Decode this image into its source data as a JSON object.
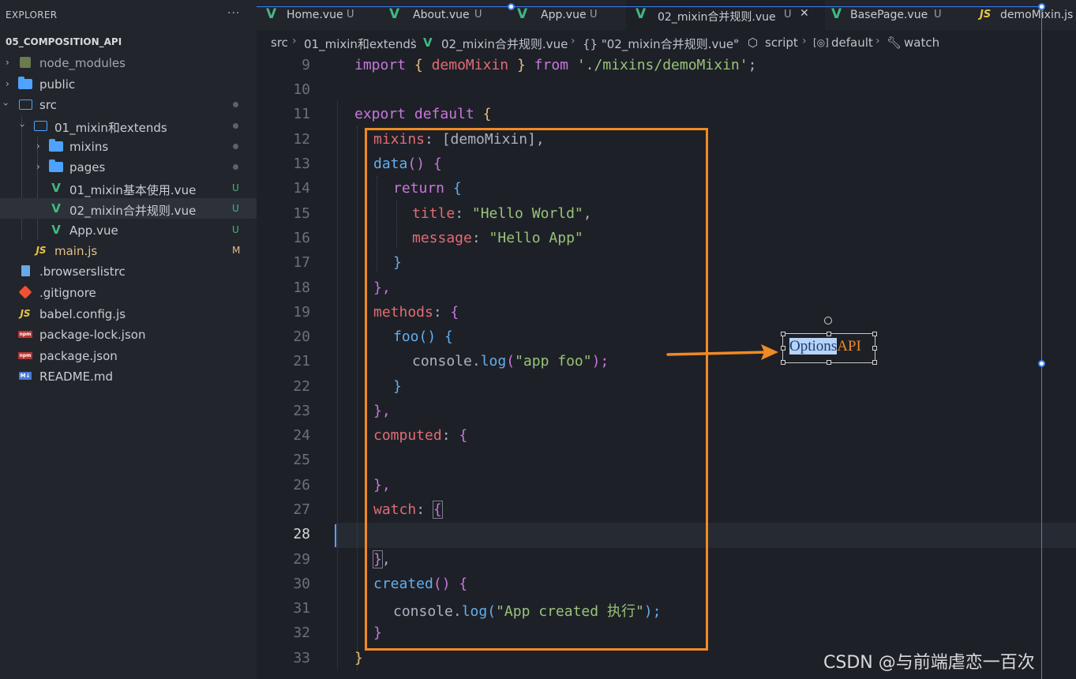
{
  "explorer": {
    "title": "EXPLORER",
    "more_label": "···",
    "project": "05_COMPOSITION_API",
    "items": [
      {
        "label": "node_modules",
        "badge": ""
      },
      {
        "label": "public",
        "badge": ""
      },
      {
        "label": "src",
        "badge": "dot"
      },
      {
        "label": "01_mixin和extends",
        "badge": "dot"
      },
      {
        "label": "mixins",
        "badge": "dot"
      },
      {
        "label": "pages",
        "badge": "dot"
      },
      {
        "label": "01_mixin基本使用.vue",
        "badge": "U"
      },
      {
        "label": "02_mixin合并规则.vue",
        "badge": "U"
      },
      {
        "label": "App.vue",
        "badge": "U"
      },
      {
        "label": "main.js",
        "badge": "M"
      },
      {
        "label": ".browserslistrc",
        "badge": ""
      },
      {
        "label": ".gitignore",
        "badge": ""
      },
      {
        "label": "babel.config.js",
        "badge": ""
      },
      {
        "label": "package-lock.json",
        "badge": ""
      },
      {
        "label": "package.json",
        "badge": ""
      },
      {
        "label": "README.md",
        "badge": ""
      }
    ]
  },
  "tabs": [
    {
      "label": "Home.vue",
      "status": "U"
    },
    {
      "label": "About.vue",
      "status": "U"
    },
    {
      "label": "App.vue",
      "status": "U"
    },
    {
      "label": "02_mixin合并规则.vue",
      "status": "U",
      "close": "✕"
    },
    {
      "label": "BasePage.vue",
      "status": "U"
    },
    {
      "label": "demoMixin.js",
      "status": ""
    }
  ],
  "breadcrumb": [
    "src",
    "01_mixin和extends",
    "02_mixin合并规则.vue",
    "{} \"02_mixin合并规则.vue\"",
    "script",
    "default",
    "watch"
  ],
  "editor": {
    "current_line": 28,
    "line_numbers": [
      "9",
      "10",
      "11",
      "12",
      "13",
      "14",
      "15",
      "16",
      "17",
      "18",
      "19",
      "20",
      "21",
      "22",
      "23",
      "24",
      "25",
      "26",
      "27",
      "28",
      "29",
      "30",
      "31",
      "32",
      "33"
    ]
  },
  "code": {
    "l9": [
      "import",
      "{",
      "demoMixin",
      "}",
      "from",
      "'./mixins/demoMixin'",
      ";"
    ],
    "l11": [
      "export",
      "default",
      "{"
    ],
    "l12": [
      "mixins",
      ": [demoMixin],"
    ],
    "l13": [
      "data",
      "()",
      "{"
    ],
    "l14": [
      "return",
      "{"
    ],
    "l15": [
      "title",
      ":",
      "\"Hello World\"",
      ","
    ],
    "l16": [
      "message",
      ":",
      "\"Hello App\""
    ],
    "l17": [
      "}"
    ],
    "l18": [
      "},"
    ],
    "l19": [
      "methods",
      ":",
      "{"
    ],
    "l20": [
      "foo",
      "()",
      "{"
    ],
    "l21": [
      "console.",
      "log",
      "(",
      "\"app foo\"",
      ");"
    ],
    "l22": [
      "}"
    ],
    "l23": [
      "},"
    ],
    "l24": [
      "computed",
      ":",
      "{"
    ],
    "l26": [
      "},"
    ],
    "l27": [
      "watch",
      ":",
      "{"
    ],
    "l29": [
      "}",
      ","
    ],
    "l30": [
      "created",
      "()",
      "{"
    ],
    "l31": [
      "console.",
      "log",
      "(",
      "\"App created 执行\"",
      ");"
    ],
    "l32": [
      "}"
    ],
    "l33": [
      "}"
    ]
  },
  "annotation": {
    "word1": "Options",
    "word2": "API",
    "color": "#f08a24"
  },
  "watermark": "CSDN @与前端虐恋一百次",
  "colors": {
    "accent": "#f08a24",
    "vue": "#41b883",
    "selection_blue": "#3b82f6"
  }
}
